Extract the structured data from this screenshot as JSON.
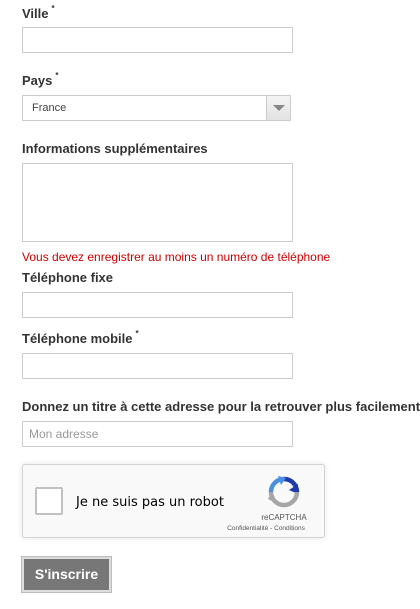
{
  "form": {
    "ville": {
      "label": "Ville",
      "required_mark": "*",
      "value": ""
    },
    "pays": {
      "label": "Pays",
      "required_mark": "*",
      "selected": "France"
    },
    "info": {
      "label": "Informations supplémentaires",
      "value": ""
    },
    "error_message": "Vous devez enregistrer au moins un numéro de téléphone",
    "tel_fixe": {
      "label": "Téléphone fixe",
      "value": ""
    },
    "tel_mobile": {
      "label": "Téléphone mobile",
      "required_mark": "*",
      "value": ""
    },
    "alias": {
      "label": "Donnez un titre à cette adresse pour la retrouver plus facilement",
      "required_mark": "*",
      "placeholder": "Mon adresse"
    },
    "recaptcha": {
      "checkbox_label": "Je ne suis pas un robot",
      "brand": "reCAPTCHA",
      "privacy_link": "Confidentialité",
      "separator": " - ",
      "terms_link": "Conditions",
      "icon": "recaptcha-logo-icon"
    },
    "submit_label": "S'inscrire"
  },
  "colors": {
    "error": "#cc0000",
    "button_bg": "#777777",
    "border": "#cccccc"
  }
}
